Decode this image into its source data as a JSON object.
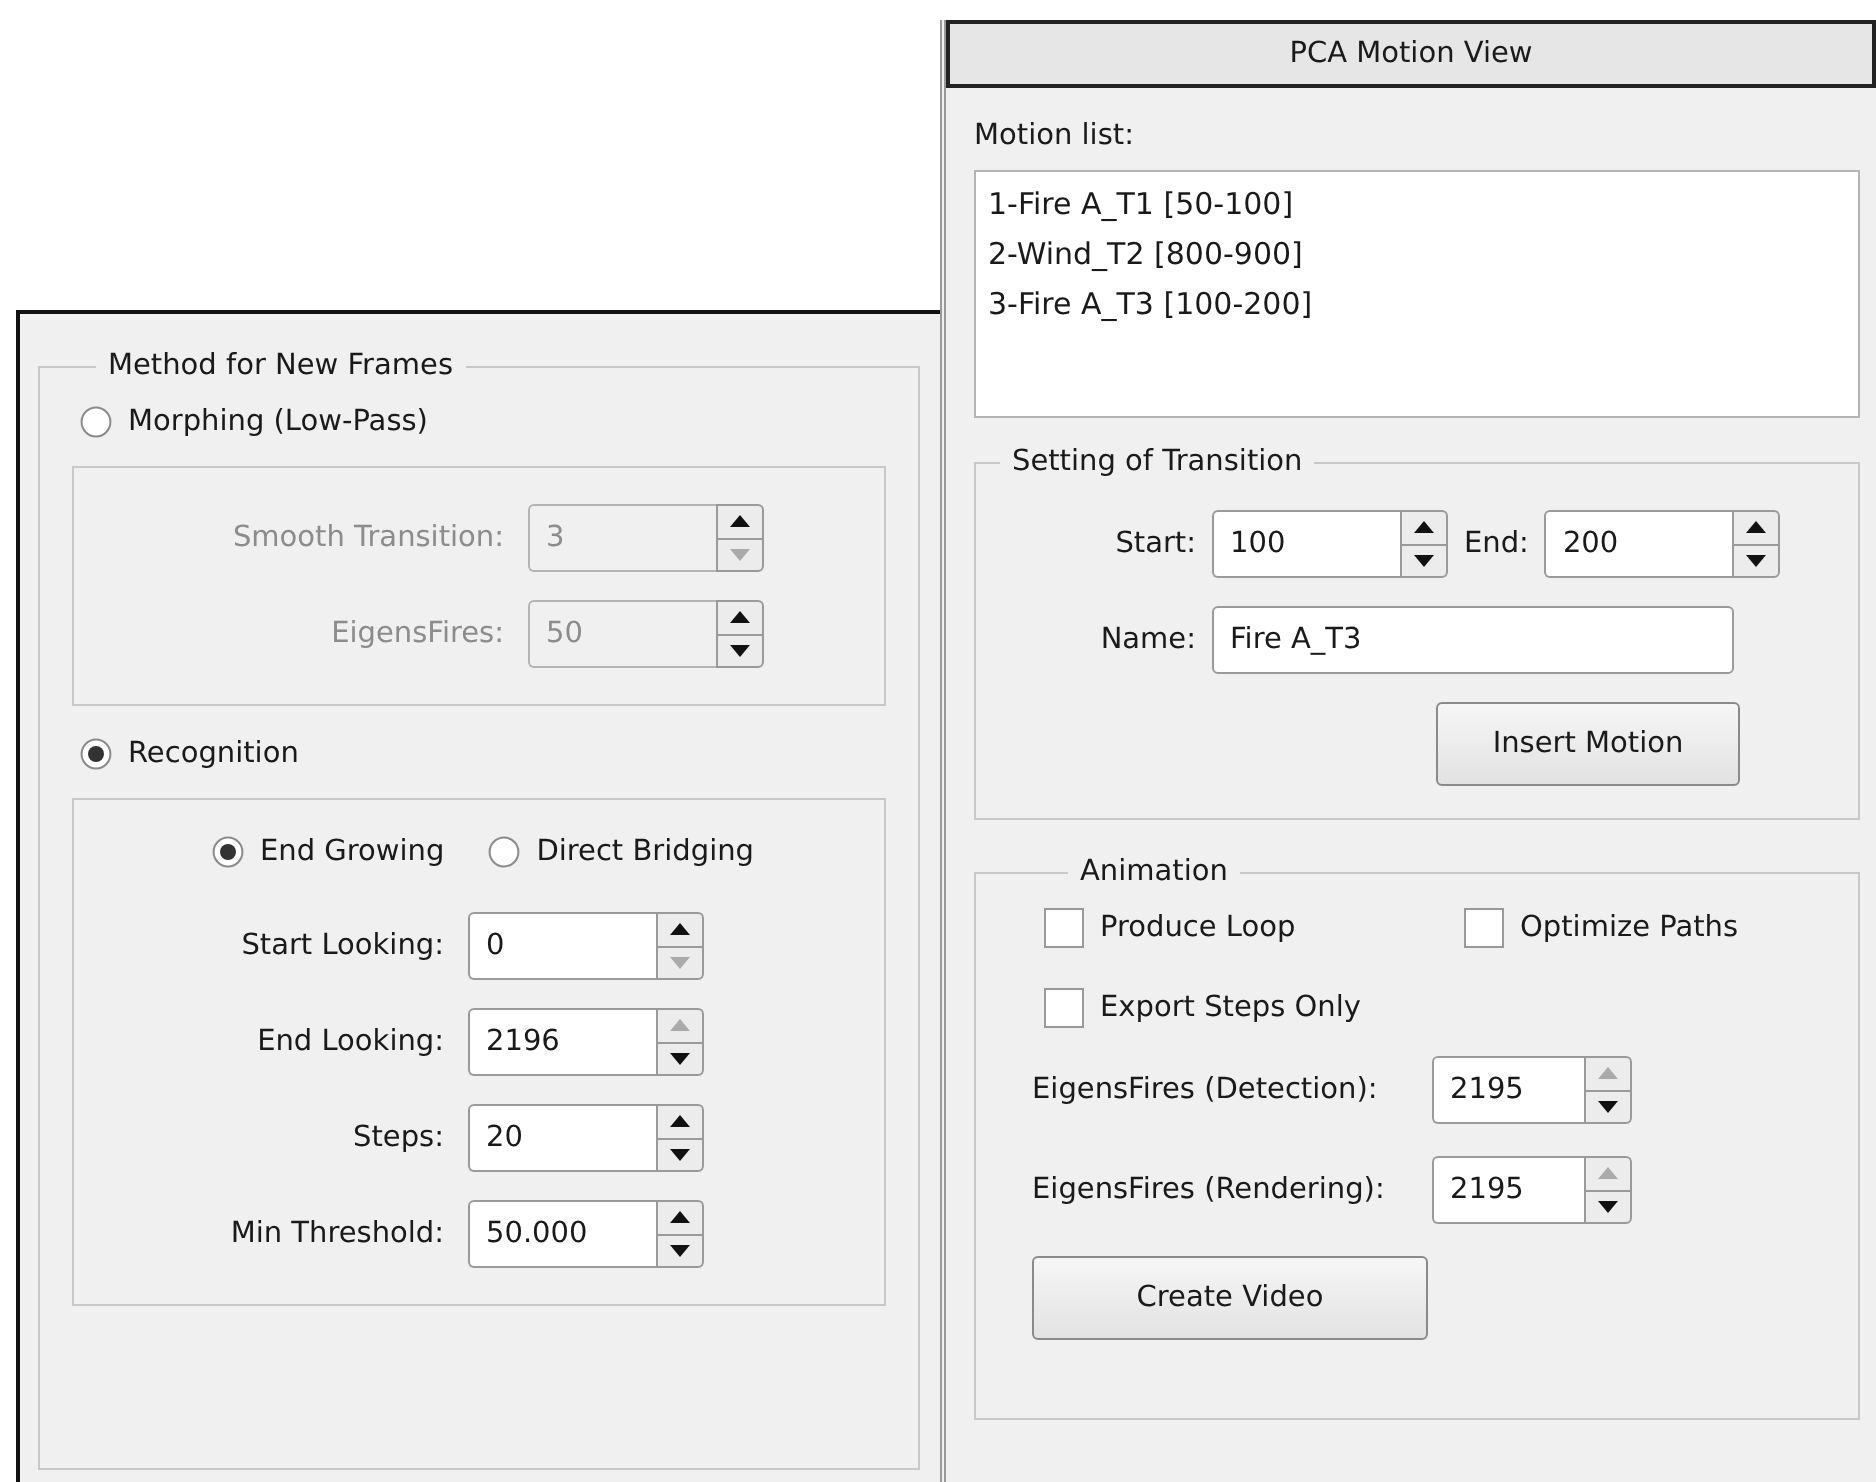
{
  "method_panel": {
    "group_title": "Method for New Frames",
    "options": [
      {
        "label": "Morphing (Low-Pass)",
        "selected": false,
        "disabled": true,
        "fields": [
          {
            "label": "Smooth Transition:",
            "value": "3",
            "up_enabled": true,
            "down_enabled": false
          },
          {
            "label": "EigensFires:",
            "value": "50",
            "up_enabled": true,
            "down_enabled": true
          }
        ]
      },
      {
        "label": "Recognition",
        "selected": true,
        "disabled": false,
        "modes": [
          {
            "label": "End Growing",
            "selected": true
          },
          {
            "label": "Direct Bridging",
            "selected": false
          }
        ],
        "fields": [
          {
            "label": "Start Looking:",
            "value": "0",
            "up_enabled": true,
            "down_enabled": false
          },
          {
            "label": "End Looking:",
            "value": "2196",
            "up_enabled": false,
            "down_enabled": true
          },
          {
            "label": "Steps:",
            "value": "20",
            "up_enabled": true,
            "down_enabled": true
          },
          {
            "label": "Min Threshold:",
            "value": "50.000",
            "up_enabled": true,
            "down_enabled": true
          }
        ]
      }
    ]
  },
  "motion_view": {
    "title": "PCA Motion View",
    "motion_list_label": "Motion list:",
    "motion_list": [
      "1-Fire A_T1 [50-100]",
      "2-Wind_T2 [800-900]",
      "3-Fire A_T3 [100-200]"
    ],
    "transition": {
      "group_title": "Setting of Transition",
      "start": {
        "label": "Start:",
        "value": "100",
        "up_enabled": true,
        "down_enabled": true
      },
      "end": {
        "label": "End:",
        "value": "200",
        "up_enabled": true,
        "down_enabled": true
      },
      "name": {
        "label": "Name:",
        "value": "Fire A_T3"
      },
      "button": "Insert Motion"
    },
    "animation": {
      "group_title": "Animation",
      "checkboxes": [
        {
          "label": "Produce Loop",
          "checked": false
        },
        {
          "label": "Optimize Paths",
          "checked": false
        },
        {
          "label": "Export Steps Only",
          "checked": false
        }
      ],
      "fields": [
        {
          "label": "EigensFires (Detection):",
          "value": "2195",
          "up_enabled": false,
          "down_enabled": true
        },
        {
          "label": "EigensFires (Rendering):",
          "value": "2195",
          "up_enabled": false,
          "down_enabled": true
        }
      ],
      "button": "Create Video"
    }
  }
}
